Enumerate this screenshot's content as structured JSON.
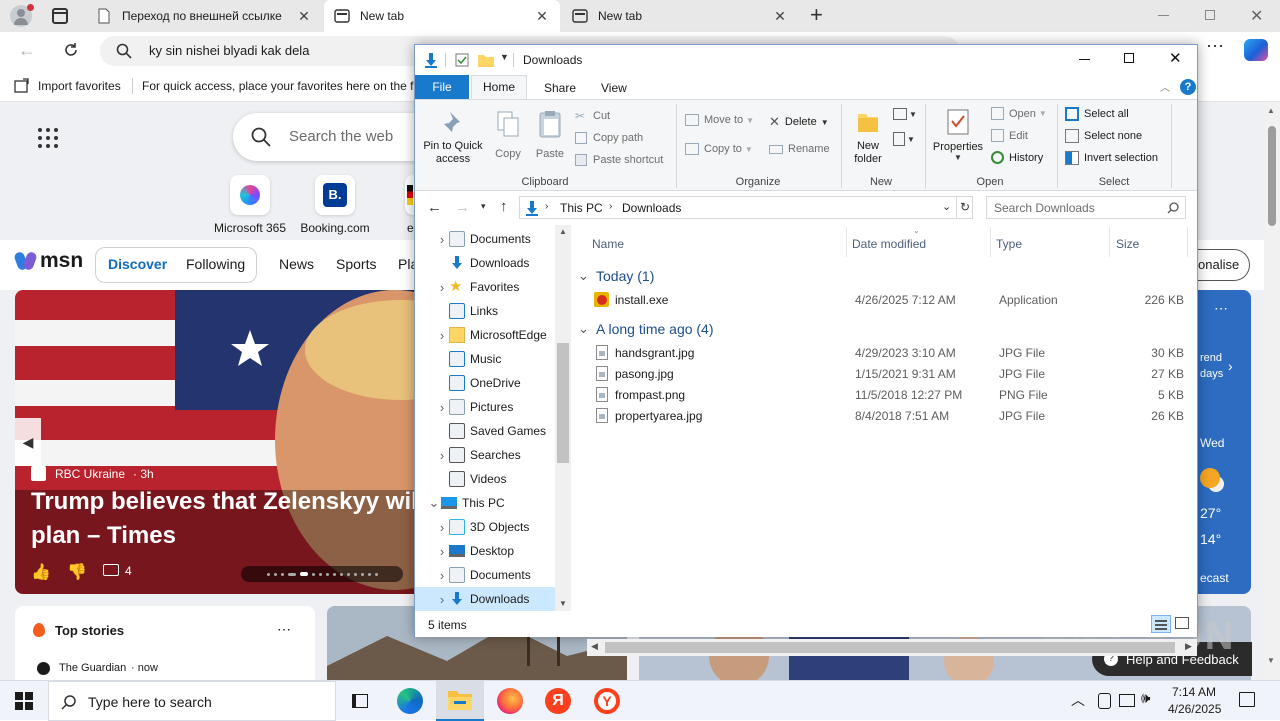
{
  "browser": {
    "tabs": [
      {
        "label": "Переход по внешней ссылке",
        "icon": "page-icon"
      },
      {
        "label": "New tab",
        "icon": "newtab-icon"
      },
      {
        "label": "New tab",
        "icon": "newtab-icon"
      }
    ],
    "address_text": "ky sin nishei blyadi kak dela",
    "favorites": {
      "import_label": "Import favorites",
      "hint": "For quick access, place your favorites here on the fa"
    }
  },
  "newtab": {
    "search_placeholder": "Search the web",
    "quick_links": [
      {
        "label": "Microsoft 365"
      },
      {
        "label": "Booking.com"
      },
      {
        "label": "e"
      }
    ],
    "msn": {
      "logo": "msn",
      "tabs": [
        "Discover",
        "Following",
        "News",
        "Sports",
        "Pla"
      ],
      "personalise_label": "onalise"
    },
    "hero": {
      "source": "RBC Ukraine",
      "age": "· 3h",
      "headline_line1": "Trump believes that Zelenskyy will a",
      "headline_line2": "plan – Times",
      "comments": "4"
    },
    "weather": {
      "trend": "rend",
      "days": "days",
      "day": "Wed",
      "high": "27°",
      "low": "14°",
      "forecast": "ecast"
    },
    "top_stories": {
      "title": "Top stories",
      "item_source": "The Guardian",
      "item_time": "· now"
    },
    "help_label": "Help and Feedback",
    "watermark": "ANY RUN"
  },
  "explorer": {
    "title": "Downloads",
    "menu": [
      "File",
      "Home",
      "Share",
      "View"
    ],
    "ribbon": {
      "clipboard": {
        "pin": "Pin to Quick access",
        "copy": "Copy",
        "paste": "Paste",
        "cut": "Cut",
        "copy_path": "Copy path",
        "paste_shortcut": "Paste shortcut",
        "group": "Clipboard"
      },
      "organize": {
        "move_to": "Move to",
        "copy_to": "Copy to",
        "delete": "Delete",
        "rename": "Rename",
        "group": "Organize"
      },
      "new": {
        "new_folder": "New folder",
        "group": "New"
      },
      "open": {
        "properties": "Properties",
        "open": "Open",
        "edit": "Edit",
        "history": "History",
        "group": "Open"
      },
      "select": {
        "select_all": "Select all",
        "select_none": "Select none",
        "invert": "Invert selection",
        "group": "Select"
      }
    },
    "breadcrumb": [
      "This PC",
      "Downloads"
    ],
    "search_placeholder": "Search Downloads",
    "nav": [
      {
        "label": "Documents",
        "icon": "documents-icon",
        "expand": true,
        "indent": 1
      },
      {
        "label": "Downloads",
        "icon": "downloads-icon",
        "expand": false,
        "indent": 1
      },
      {
        "label": "Favorites",
        "icon": "star-icon",
        "expand": true,
        "indent": 1
      },
      {
        "label": "Links",
        "icon": "links-icon",
        "expand": false,
        "indent": 1
      },
      {
        "label": "MicrosoftEdge",
        "icon": "folder-icon",
        "expand": true,
        "indent": 1
      },
      {
        "label": "Music",
        "icon": "music-icon",
        "expand": false,
        "indent": 1
      },
      {
        "label": "OneDrive",
        "icon": "cloud-icon",
        "expand": false,
        "indent": 1
      },
      {
        "label": "Pictures",
        "icon": "pictures-icon",
        "expand": true,
        "indent": 1
      },
      {
        "label": "Saved Games",
        "icon": "games-icon",
        "expand": false,
        "indent": 1
      },
      {
        "label": "Searches",
        "icon": "search-icon",
        "expand": true,
        "indent": 1
      },
      {
        "label": "Videos",
        "icon": "videos-icon",
        "expand": false,
        "indent": 1
      },
      {
        "label": "This PC",
        "icon": "pc-icon",
        "expand": "open",
        "indent": 0
      },
      {
        "label": "3D Objects",
        "icon": "cube-icon",
        "expand": true,
        "indent": 1
      },
      {
        "label": "Desktop",
        "icon": "desktop-icon",
        "expand": true,
        "indent": 1
      },
      {
        "label": "Documents",
        "icon": "documents-icon",
        "expand": true,
        "indent": 1
      },
      {
        "label": "Downloads",
        "icon": "downloads-icon",
        "expand": true,
        "indent": 1,
        "selected": true
      }
    ],
    "columns": [
      "Name",
      "Date modified",
      "Type",
      "Size"
    ],
    "groups": [
      {
        "header": "Today (1)",
        "files": [
          {
            "name": "install.exe",
            "date": "4/26/2025 7:12 AM",
            "type": "Application",
            "size": "226 KB",
            "icon": "installer-icon"
          }
        ]
      },
      {
        "header": "A long time ago (4)",
        "files": [
          {
            "name": "handsgrant.jpg",
            "date": "4/29/2023 3:10 AM",
            "type": "JPG File",
            "size": "30 KB",
            "icon": "image-file-icon"
          },
          {
            "name": "pasong.jpg",
            "date": "1/15/2021 9:31 AM",
            "type": "JPG File",
            "size": "27 KB",
            "icon": "image-file-icon"
          },
          {
            "name": "frompast.png",
            "date": "11/5/2018 12:27 PM",
            "type": "PNG File",
            "size": "5 KB",
            "icon": "image-file-icon"
          },
          {
            "name": "propertyarea.jpg",
            "date": "8/4/2018 7:51 AM",
            "type": "JPG File",
            "size": "26 KB",
            "icon": "image-file-icon"
          }
        ]
      }
    ],
    "status": "5 items"
  },
  "taskbar": {
    "search_placeholder": "Type here to search",
    "time": "7:14 AM",
    "date": "4/26/2025"
  },
  "colors": {
    "accent": "#1a73e8",
    "explorer_blue": "#1979ca",
    "nav_selected": "#cce8ff",
    "msn_blue": "#0f6cbd"
  }
}
